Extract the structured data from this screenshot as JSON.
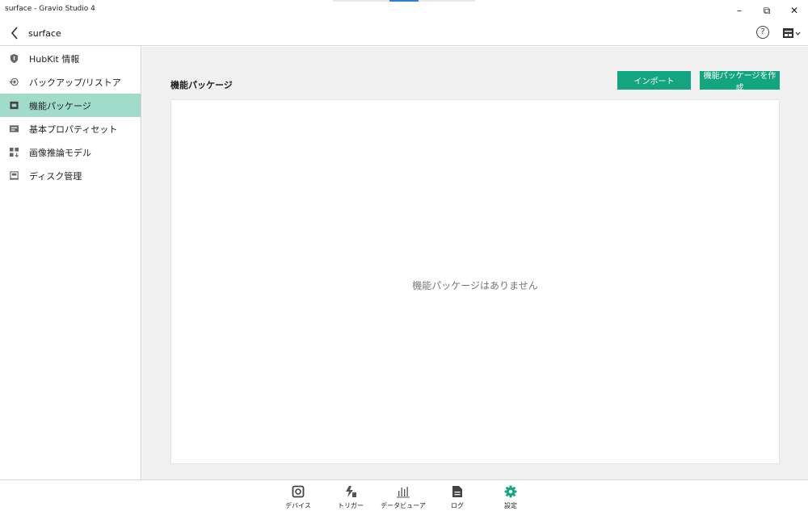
{
  "window": {
    "title": "surface - Gravio Studio 4",
    "minimize": "–",
    "maximize": "⧉",
    "close": "✕"
  },
  "header": {
    "breadcrumb": "surface",
    "help": "?"
  },
  "sidebar": {
    "items": [
      {
        "label": "HubKit 情報",
        "icon": "shield-icon"
      },
      {
        "label": "バックアップ/リストア",
        "icon": "backup-icon"
      },
      {
        "label": "機能パッケージ",
        "icon": "package-icon",
        "active": true
      },
      {
        "label": "基本プロパティセット",
        "icon": "property-card-icon"
      },
      {
        "label": "画像推論モデル",
        "icon": "model-grid-icon"
      },
      {
        "label": "ディスク管理",
        "icon": "disk-icon"
      }
    ]
  },
  "main": {
    "section_title": "機能パッケージ",
    "import_label": "インポート",
    "create_label": "機能パッケージを作成",
    "empty_message": "機能パッケージはありません"
  },
  "bottom_nav": [
    {
      "label": "デバイス",
      "icon": "device-icon"
    },
    {
      "label": "トリガー",
      "icon": "trigger-icon"
    },
    {
      "label": "データビューア",
      "icon": "chart-icon"
    },
    {
      "label": "ログ",
      "icon": "log-icon"
    },
    {
      "label": "設定",
      "icon": "settings-icon",
      "active": true
    }
  ],
  "colors": {
    "accent": "#12a57f",
    "sidebar_active": "#a1dccb",
    "main_background": "#f0f0f0"
  }
}
